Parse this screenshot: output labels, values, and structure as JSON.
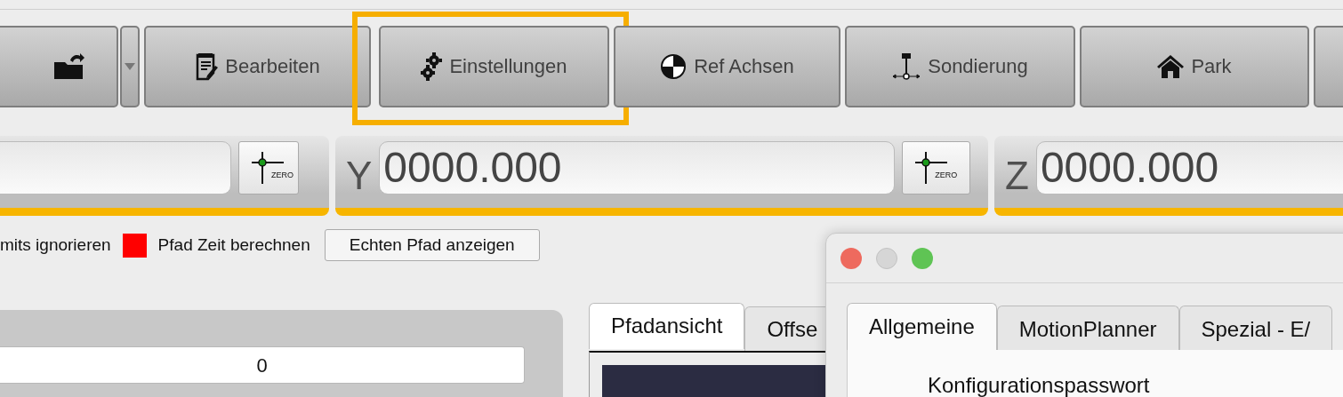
{
  "toolbar": {
    "buttons": [
      {
        "label": "Bearbeiten",
        "highlighted": false
      },
      {
        "label": "Einstellungen",
        "highlighted": true
      },
      {
        "label": "Ref Achsen",
        "highlighted": false
      },
      {
        "label": "Sondierung",
        "highlighted": false
      },
      {
        "label": "Park",
        "highlighted": false
      }
    ]
  },
  "axes": [
    {
      "zero": "ZERO"
    },
    {
      "label": "Y",
      "value": "0000.000",
      "zero": "ZERO"
    },
    {
      "label": "Z",
      "value": "0000.000"
    }
  ],
  "options": {
    "items": [
      {
        "label": "mits ignorieren"
      },
      {
        "label": "Pfad Zeit berechnen",
        "color": "#ff0000"
      }
    ],
    "button": "Echten Pfad anzeigen"
  },
  "left_panel": {
    "value": "0"
  },
  "view_tabs": [
    {
      "label": "Pfadansicht",
      "selected": true
    },
    {
      "label": "Offse",
      "selected": false
    }
  ],
  "dialog": {
    "tabs": [
      {
        "label": "Allgemeine",
        "selected": true
      },
      {
        "label": "MotionPlanner",
        "selected": false
      },
      {
        "label": "Spezial - E/",
        "selected": false
      }
    ],
    "fields": [
      {
        "label": "Konfigurationspasswort"
      }
    ]
  }
}
